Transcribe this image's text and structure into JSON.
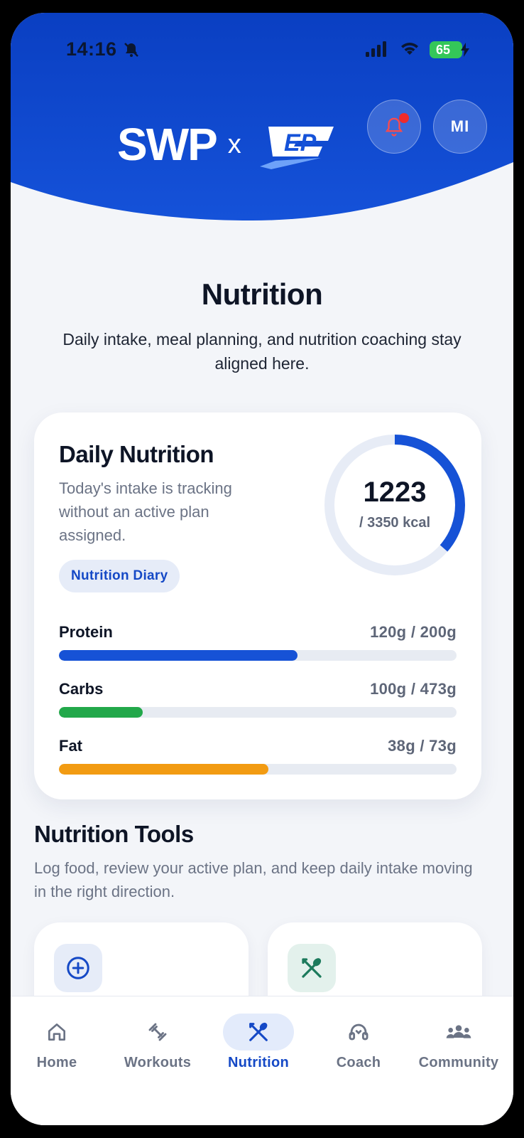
{
  "status_bar": {
    "time": "14:16",
    "battery": "65"
  },
  "header": {
    "brand_left": "SWP",
    "brand_separator": "x",
    "brand_right": "EP",
    "avatar_initials": "MI"
  },
  "page": {
    "title": "Nutrition",
    "subtitle": "Daily intake, meal planning, and nutrition coaching stay aligned here."
  },
  "daily_card": {
    "title": "Daily Nutrition",
    "subtitle": "Today's intake is tracking without an active plan assigned.",
    "diary_button": "Nutrition Diary",
    "calories_consumed": "1223",
    "calories_goal": "/ 3350 kcal",
    "calories_progress": 0.365,
    "macros": [
      {
        "name": "Protein",
        "value": "120g / 200g",
        "progress": 0.6,
        "color": "#1652d6"
      },
      {
        "name": "Carbs",
        "value": "100g / 473g",
        "progress": 0.21,
        "color": "#22a84a"
      },
      {
        "name": "Fat",
        "value": "38g / 73g",
        "progress": 0.527,
        "color": "#f29b12"
      }
    ]
  },
  "tools": {
    "title": "Nutrition Tools",
    "subtitle": "Log food, review your active plan, and keep daily intake moving in the right direction.",
    "cards": [
      {
        "icon": "plus-circle-icon"
      },
      {
        "icon": "utensils-icon"
      }
    ]
  },
  "tabbar": {
    "tabs": [
      {
        "label": "Home",
        "icon": "home-icon"
      },
      {
        "label": "Workouts",
        "icon": "dumbbell-icon"
      },
      {
        "label": "Nutrition",
        "icon": "utensils-icon",
        "active": true
      },
      {
        "label": "Coach",
        "icon": "headset-icon"
      },
      {
        "label": "Community",
        "icon": "people-icon"
      }
    ]
  },
  "colors": {
    "brand_blue": "#1549c6",
    "header_gradient_top": "#0d40c0",
    "background": "#f3f5f9"
  }
}
